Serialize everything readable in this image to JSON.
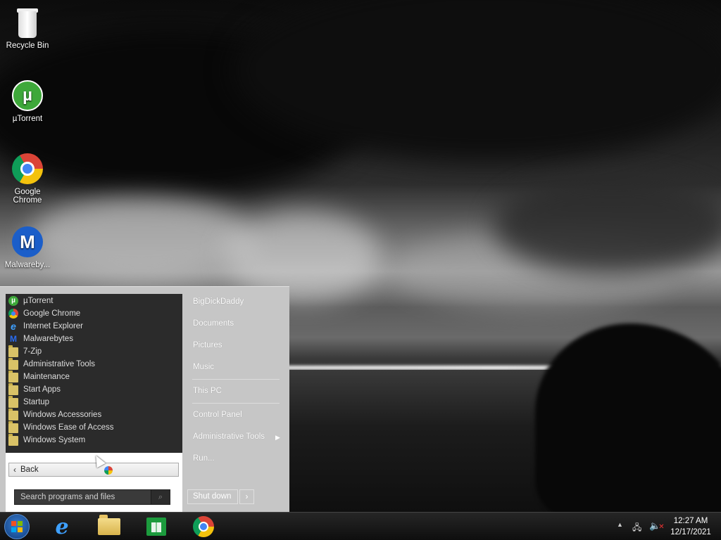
{
  "desktop": {
    "icons": [
      {
        "label": "Recycle Bin",
        "icon": "recycle-bin-icon"
      },
      {
        "label": "µTorrent",
        "icon": "utorrent-icon"
      },
      {
        "label": "Google Chrome",
        "icon": "chrome-icon"
      },
      {
        "label": "Malwareby...",
        "icon": "malwarebytes-icon"
      }
    ]
  },
  "start_menu": {
    "programs": [
      {
        "label": "µTorrent",
        "icon": "utorrent-icon"
      },
      {
        "label": "Google Chrome",
        "icon": "chrome-icon"
      },
      {
        "label": "Internet Explorer",
        "icon": "internet-explorer-icon"
      },
      {
        "label": "Malwarebytes",
        "icon": "malwarebytes-icon"
      },
      {
        "label": "7-Zip",
        "icon": "folder-icon"
      },
      {
        "label": "Administrative Tools",
        "icon": "folder-icon"
      },
      {
        "label": "Maintenance",
        "icon": "folder-icon"
      },
      {
        "label": "Start Apps",
        "icon": "folder-icon"
      },
      {
        "label": "Startup",
        "icon": "folder-icon"
      },
      {
        "label": "Windows Accessories",
        "icon": "folder-icon"
      },
      {
        "label": "Windows Ease of Access",
        "icon": "folder-icon"
      },
      {
        "label": "Windows System",
        "icon": "folder-icon"
      }
    ],
    "back_label": "Back",
    "search_placeholder": "Search programs and files",
    "right": {
      "user": "BigDickDaddy",
      "documents": "Documents",
      "pictures": "Pictures",
      "music": "Music",
      "this_pc": "This PC",
      "control_panel": "Control Panel",
      "admin_tools": "Administrative Tools",
      "run": "Run...",
      "shutdown": "Shut down"
    }
  },
  "taskbar": {
    "apps": [
      "internet-explorer-icon",
      "file-explorer-icon",
      "store-icon",
      "chrome-icon"
    ],
    "clock_time": "12:27 AM",
    "clock_date": "12/17/2021"
  },
  "colors": {
    "start_menu_bg": "#c6c6c6",
    "program_list_bg": "#2b2b2b",
    "taskbar_bg": "#1a1a1a",
    "utorrent_green": "#3ea83a",
    "malwarebytes_blue": "#1b5ec9"
  }
}
